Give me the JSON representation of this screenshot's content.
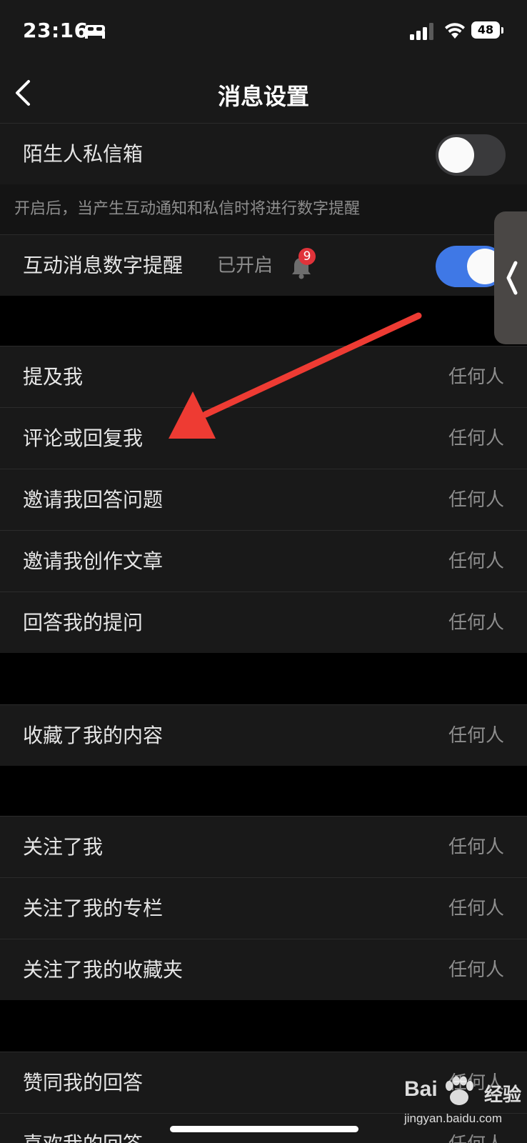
{
  "status_bar": {
    "time": "23:16",
    "battery_level": "48",
    "icons": [
      "bed-icon",
      "signal-icon",
      "wifi-icon",
      "battery-icon"
    ]
  },
  "nav": {
    "title": "消息设置",
    "back_icon": "chevron-left-icon"
  },
  "stranger_inbox": {
    "label": "陌生人私信箱",
    "enabled": false
  },
  "hint": "开启后，当产生互动通知和私信时将进行数字提醒",
  "digit_reminder": {
    "label": "互动消息数字提醒",
    "status": "已开启",
    "badge_count": "9",
    "enabled": true
  },
  "groups": [
    {
      "items": [
        {
          "label": "提及我",
          "value": "任何人"
        },
        {
          "label": "评论或回复我",
          "value": "任何人"
        },
        {
          "label": "邀请我回答问题",
          "value": "任何人"
        },
        {
          "label": "邀请我创作文章",
          "value": "任何人"
        },
        {
          "label": "回答我的提问",
          "value": "任何人"
        }
      ]
    },
    {
      "items": [
        {
          "label": "收藏了我的内容",
          "value": "任何人"
        }
      ]
    },
    {
      "items": [
        {
          "label": "关注了我",
          "value": "任何人"
        },
        {
          "label": "关注了我的专栏",
          "value": "任何人"
        },
        {
          "label": "关注了我的收藏夹",
          "value": "任何人"
        }
      ]
    },
    {
      "items": [
        {
          "label": "赞同我的回答",
          "value": "任何人"
        },
        {
          "label": "喜欢我的回答",
          "value": "任何人"
        }
      ]
    }
  ],
  "watermark": {
    "brand_prefix": "Bai",
    "brand_cn": "经验",
    "url": "jingyan.baidu.com"
  },
  "colors": {
    "toggle_on": "#3f78e6",
    "annotation_arrow": "#ee3b33",
    "badge": "#e0333a"
  }
}
